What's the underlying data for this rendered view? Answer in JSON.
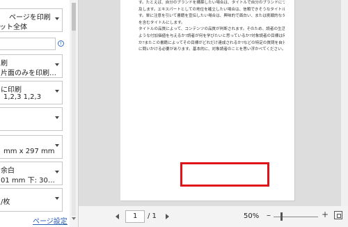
{
  "sidebar": {
    "print_what": {
      "line1": "ページを印刷",
      "line2": "ット全体"
    },
    "sides": {
      "line1": "刷",
      "line2": "片面のみを印刷…"
    },
    "collate": {
      "line1": "に印刷",
      "line2": "1,2,3 1,2,3"
    },
    "paper_size": {
      "line2": "mm x 297 mm"
    },
    "margins": {
      "line1": "余白",
      "line2": "01 mm 下: 30…"
    },
    "per_sheet": {
      "line1": "/枚"
    },
    "info_icon": "i",
    "page_setup_link": "ページ設定"
  },
  "preview": {
    "lines": [
      "す。たとえば、自分のブランドを構築したい場合は、タイトルで自分のブランドについて言",
      "及します。エキスパートとしての地位を確立したい場合は、信頼できそうなタイトルにしま",
      "す。単に注意を引いて書籍を宣伝したい場合は、興味的で面白い、または挑戦的なタイトル",
      "を含むタイトルにします。",
      "タイトルの品質によって、コンテンツの品質が判断されます。そのため、読者の生活にどの",
      "ような付加価値を与えるか?読者が何を学びたいと思っているか?対象読者の目標は何",
      "か?またこの書籍によってその目標がどれだけ達成されるか?などの特定の質問を自分自身",
      "に問いかける必要があります。基本的に、対象読者のことを思い浮かべてください。"
    ]
  },
  "footer": {
    "page_current": "1",
    "page_total": "/ 1",
    "zoom_percent": "50%",
    "zoom_minus": "–",
    "zoom_plus": "+",
    "zoom_level": 0.5
  },
  "colors": {
    "highlight": "#e0131a",
    "link": "#2b5fb3"
  }
}
